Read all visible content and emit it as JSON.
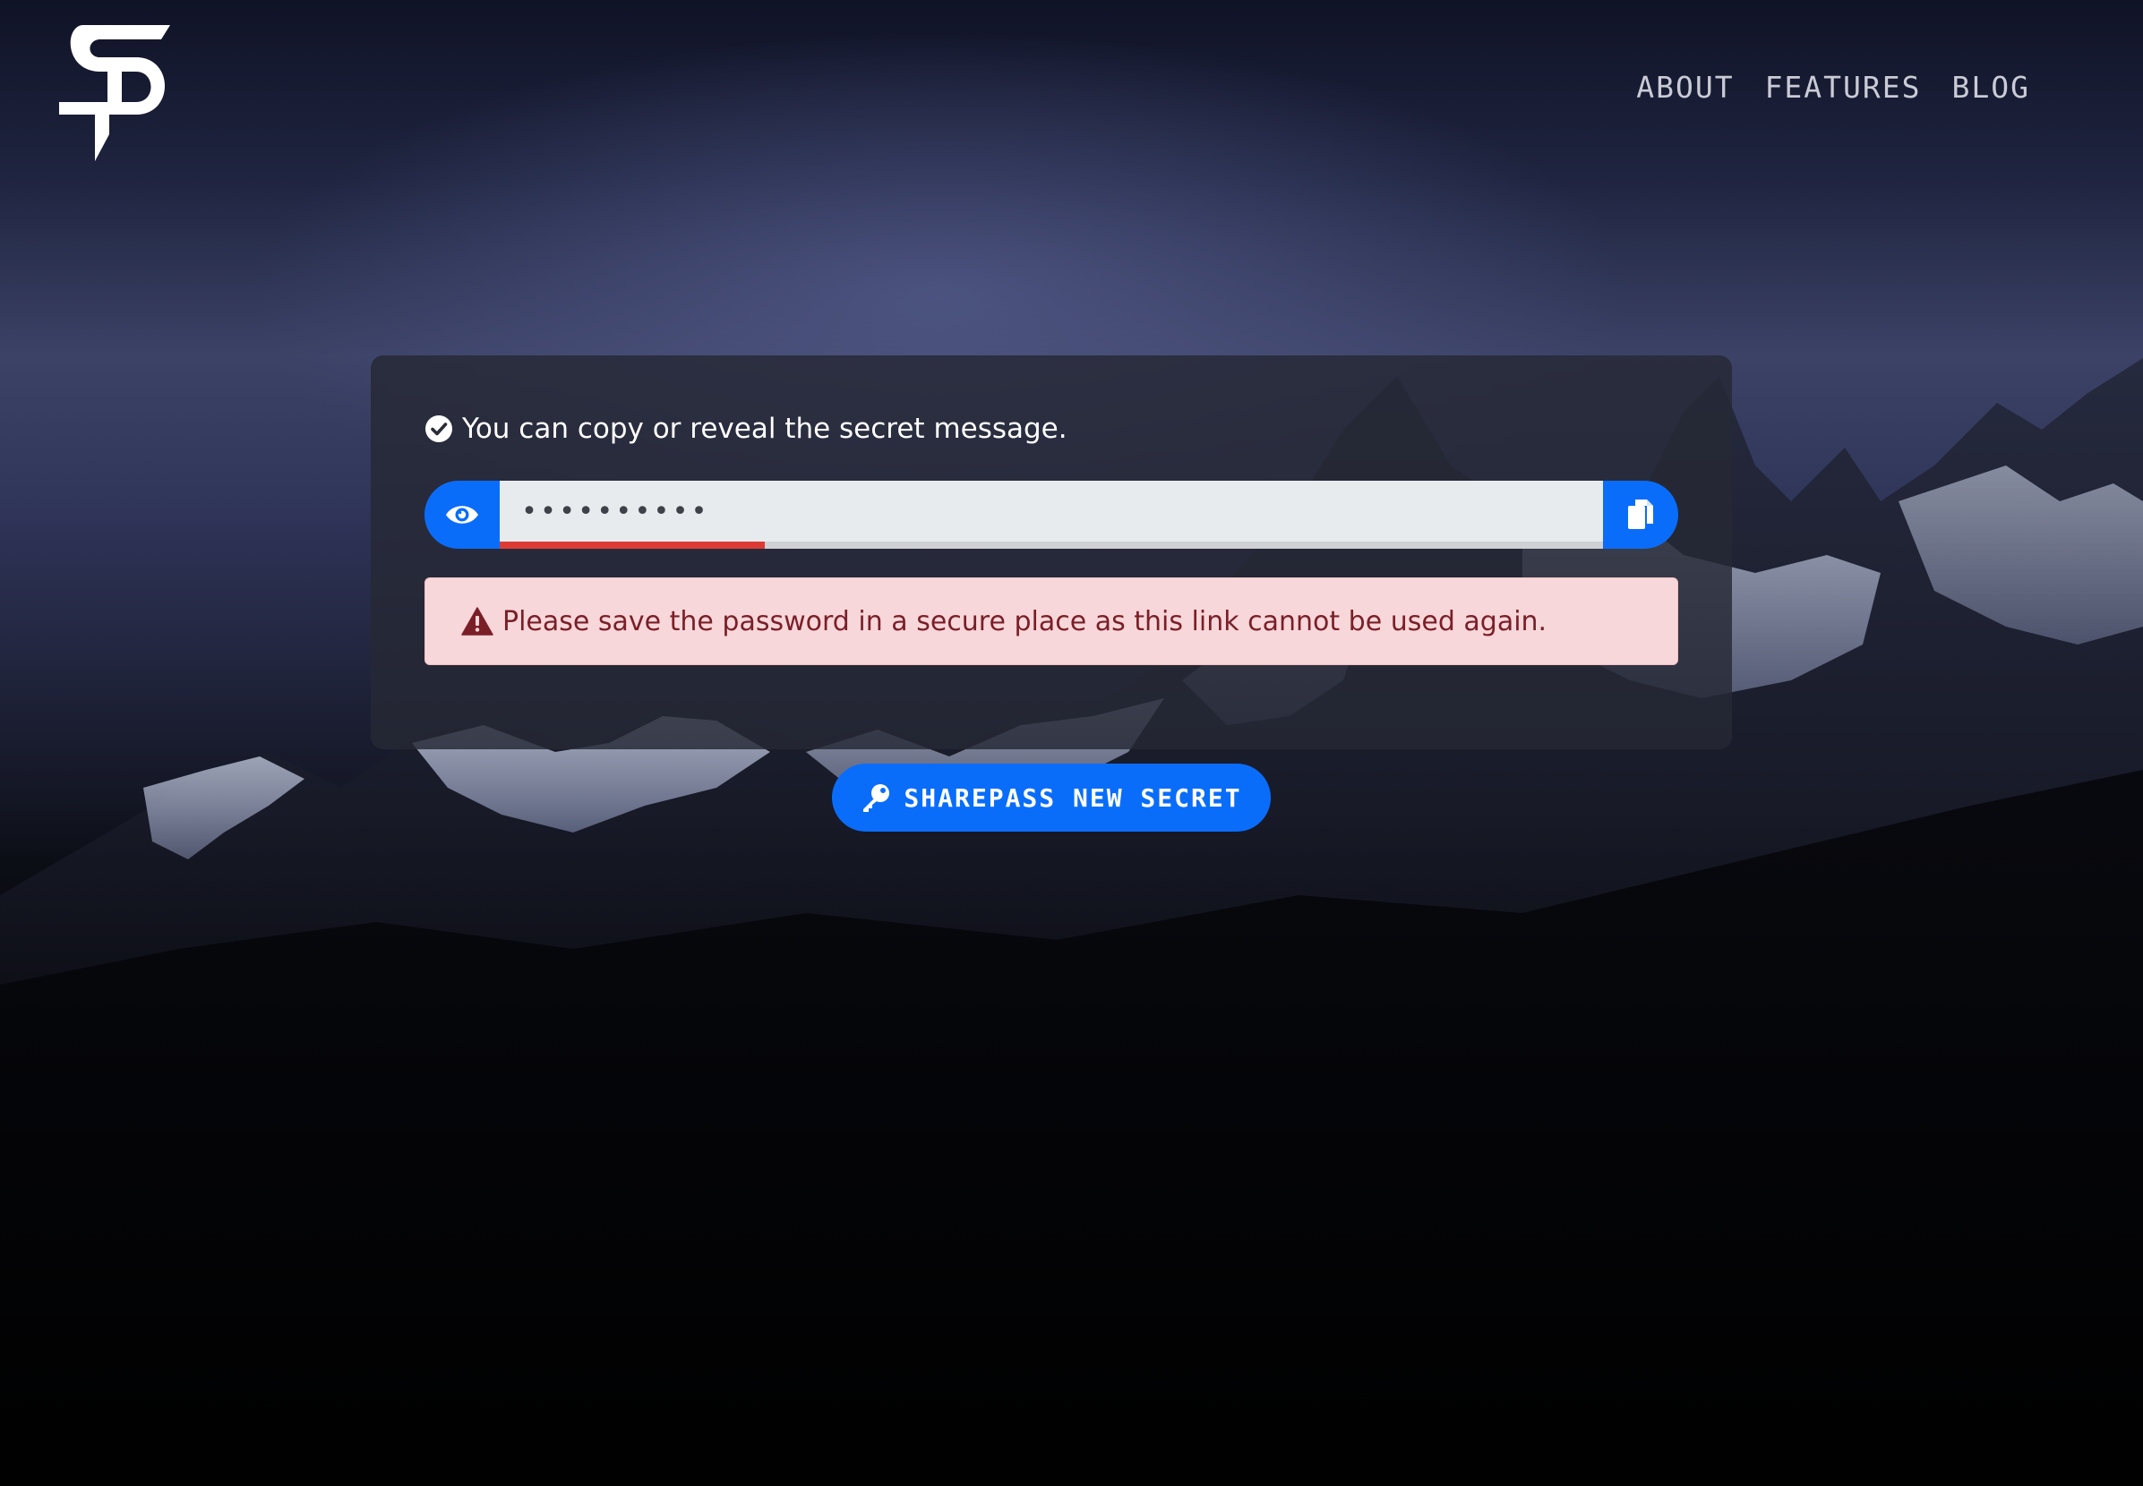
{
  "nav": {
    "items": [
      {
        "label": "ABOUT"
      },
      {
        "label": "FEATURES"
      },
      {
        "label": "BLOG"
      }
    ]
  },
  "card": {
    "notice_text": "You can copy or reveal the secret message.",
    "secret_value": "••••••••••",
    "strength_fraction": 0.24,
    "alert_text": "Please save the password in a secure place as this link cannot be used again."
  },
  "actions": {
    "new_secret_label": "SHAREPASS NEW SECRET"
  },
  "colors": {
    "primary": "#0a6dfa",
    "strength": "#dc3b35",
    "alert_bg": "#f8d7da",
    "alert_text": "#7a1f28"
  },
  "icons": {
    "logo": "sharepass-logo",
    "notice": "check-circle-icon",
    "reveal": "eye-icon",
    "copy": "copy-icon",
    "alert": "warning-triangle-icon",
    "new_secret": "key-icon"
  }
}
